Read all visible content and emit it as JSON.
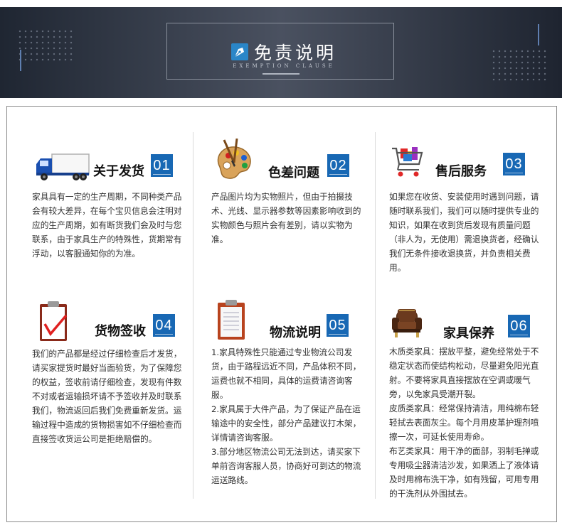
{
  "banner": {
    "title": "免责说明",
    "subtitle": "EXEMPTION CLAUSE"
  },
  "cards": [
    {
      "number": "01",
      "title": "关于发货",
      "icon": "delivery-truck-icon",
      "body": [
        "家具具有一定的生产周期，不同种类产品会有较大差异，在每个宝贝信息会注明对应的生产周期，如有断货我们会及时与您联系，由于家具生产的特殊性，货期常有浮动，以客服通知你的为准。"
      ]
    },
    {
      "number": "02",
      "title": "色差问题",
      "icon": "paint-palette-icon",
      "body": [
        "产品图片均为实物照片，但由于拍摄技术、光线、显示器参数等因素影响收到的实物颜色与照片会有差别，请以实物为准。"
      ]
    },
    {
      "number": "03",
      "title": "售后服务",
      "icon": "shopping-cart-icon",
      "body": [
        "如果您在收货、安装使用时遇到问题，请随时联系我们，我们可以随时提供专业的知识，如果在收到货后发现有质量问题（非人为，无使用）需退换货者，经确认我们无条件接收退换货，并负责相关费用。"
      ]
    },
    {
      "number": "04",
      "title": "货物签收",
      "icon": "checklist-clipboard-icon",
      "body": [
        "我们的产品都是经过仔细检查后才发货，请买家提货时最好当面验货，为了保障您的权益，签收前请仔细检查，发现有件数不对或者运输损坏请不予签收并及时联系我们，物流返回后我们免费重新发货。运输过程中造成的货物损害如不仔细检查而直接签收货运公司是拒绝赔偿的。"
      ]
    },
    {
      "number": "05",
      "title": "物流说明",
      "icon": "clipboard-icon",
      "body": [
        "1.家具特殊性只能通过专业物流公司发货，由于路程远近不同，产品体积不同，运费也就不相同，具体的运费请咨询客服。",
        "2.家具属于大件产品，为了保证产品在运输途中的安全性，部分产品建议打木架，详情请咨询客服。",
        "3.部分地区物流公司无法到达，请买家下单前咨询客服人员，协商好可到达的物流运送路线。"
      ]
    },
    {
      "number": "06",
      "title": "家具保养",
      "icon": "armchair-icon",
      "body": [
        "木质类家具：摆放平整，避免经常处于不稳定状态而使结构松动，尽量避免阳光直射。不要将家具直接摆放在空调或暖气旁，以免家具受潮开裂。",
        "皮质类家具：经常保持清洁，用纯棉布轻轻拭去表面灰尘。每个月用皮革护理剂喷擦一次，可延长使用寿命。",
        "布艺类家具：用干净的面部，羽制毛掸或专用吸尘器清洁沙发，如果洒上了液体请及时用棉布洗干净，如有残留，可用专用的干洗剂从外围拭去。"
      ]
    }
  ]
}
